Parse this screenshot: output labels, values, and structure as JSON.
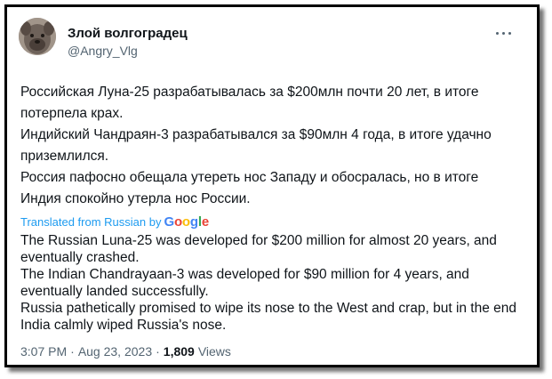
{
  "author": {
    "name": "Злой волгоградец",
    "handle": "@Angry_Vlg"
  },
  "tweet": {
    "ru_lines": [
      "Российская Луна-25 разрабатывалась за $200млн  почти 20 лет, в итоге потерпела крах.",
      "Индийский Чандраян-3 разрабатывался за $90млн 4 года, в итоге удачно приземлился.",
      "Россия пафосно обещала утереть нос Западу и обосралась, но в итоге Индия спокойно утерла нос России."
    ],
    "translated_label": "Translated from Russian by",
    "translator_brand": "Google",
    "en_lines": [
      "The Russian Luna-25 was developed for $200 million for almost 20 years, and eventually crashed.",
      "The Indian Chandrayaan-3 was developed for $90 million for 4 years, and eventually landed successfully.",
      "Russia pathetically promised to wipe its nose to the West and crap, but in the end India calmly wiped Russia's nose."
    ]
  },
  "meta": {
    "time": "3:07 PM",
    "separator": "·",
    "date": "Aug 23, 2023",
    "views_count": "1,809",
    "views_label": "Views"
  },
  "colors": {
    "text": "#0f1419",
    "secondary": "#536471",
    "link": "#1d9bf0"
  },
  "icons": {
    "more": "more-horizontal-icon"
  }
}
